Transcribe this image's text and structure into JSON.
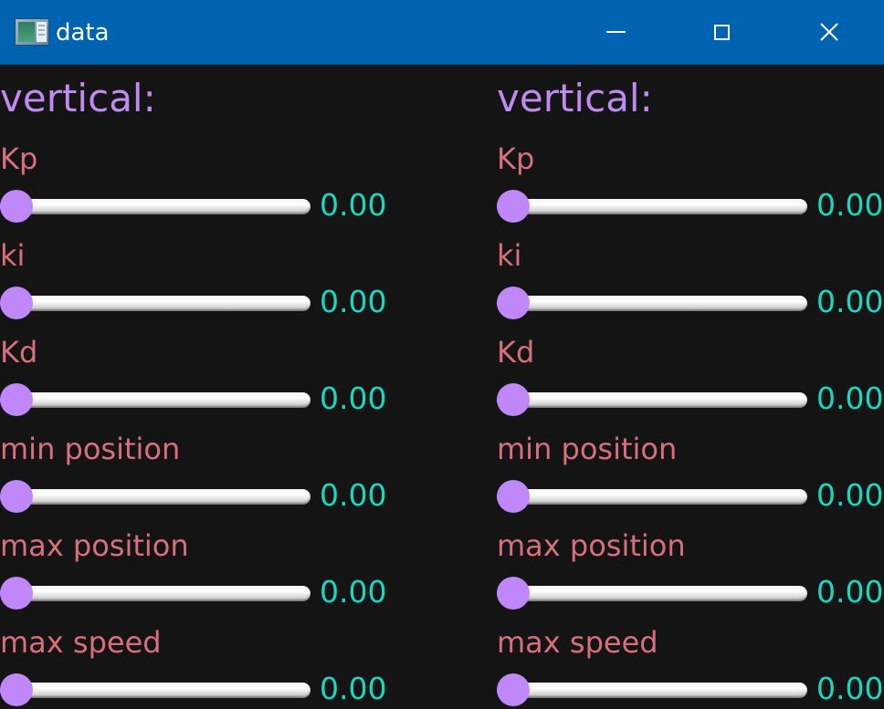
{
  "window": {
    "title": "data",
    "icon": "app-window-icon",
    "controls": {
      "minimize_icon": "minimize-icon",
      "maximize_icon": "maximize-icon",
      "close_icon": "close-icon"
    }
  },
  "colors": {
    "titlebar": "#0063b1",
    "background": "#141414",
    "heading": "#bf8bf0",
    "label": "#d86f7d",
    "value": "#1ad8bf",
    "thumb": "#bf87f8"
  },
  "panels": [
    {
      "heading": "vertical:",
      "params": [
        {
          "label": "Kp",
          "value": "0.00",
          "level": 0
        },
        {
          "label": "ki",
          "value": "0.00",
          "level": 0
        },
        {
          "label": "Kd",
          "value": "0.00",
          "level": 0
        },
        {
          "label": "min position",
          "value": "0.00",
          "level": 0
        },
        {
          "label": "max position",
          "value": "0.00",
          "level": 0
        },
        {
          "label": "max speed",
          "value": "0.00",
          "level": 0
        }
      ]
    },
    {
      "heading": "vertical:",
      "params": [
        {
          "label": "Kp",
          "value": "0.00",
          "level": 0
        },
        {
          "label": "ki",
          "value": "0.00",
          "level": 0
        },
        {
          "label": "Kd",
          "value": "0.00",
          "level": 0
        },
        {
          "label": "min position",
          "value": "0.00",
          "level": 0
        },
        {
          "label": "max position",
          "value": "0.00",
          "level": 0
        },
        {
          "label": "max speed",
          "value": "0.00",
          "level": 0
        }
      ]
    }
  ]
}
